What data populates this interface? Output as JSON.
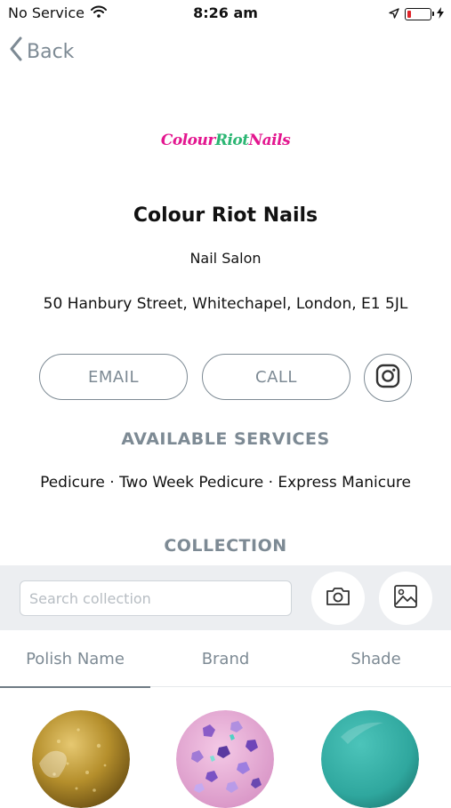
{
  "status_bar": {
    "carrier": "No Service",
    "time": "8:26 am",
    "battery_color": "#e0242a"
  },
  "nav": {
    "back_label": "Back",
    "back_icon": "chevron-left-icon"
  },
  "logo": {
    "part1": "Colour",
    "part2": "Riot",
    "part3": "Nails",
    "colors": {
      "primary": "#e3168f",
      "secondary": "#2bb673"
    }
  },
  "salon": {
    "name": "Colour Riot Nails",
    "type": "Nail Salon",
    "address": "50 Hanbury Street, Whitechapel, London, E1 5JL"
  },
  "actions": {
    "email_label": "EMAIL",
    "call_label": "CALL",
    "instagram_icon": "instagram-icon"
  },
  "services": {
    "title": "AVAILABLE SERVICES",
    "list": "Pedicure · Two Week Pedicure · Express Manicure"
  },
  "collection": {
    "title": "COLLECTION",
    "search_placeholder": "Search collection",
    "search_value": "",
    "camera_icon": "camera-icon",
    "gallery_icon": "image-gallery-icon",
    "tabs": [
      {
        "label": "Polish Name",
        "active": true
      },
      {
        "label": "Brand",
        "active": false
      },
      {
        "label": "Shade",
        "active": false
      }
    ],
    "swatches": [
      {
        "name": "gold-glitter",
        "color": "#b58f2c"
      },
      {
        "name": "pink-holo-glitter",
        "color": "#e3a6cf"
      },
      {
        "name": "teal",
        "color": "#2fa79e"
      }
    ]
  },
  "theme": {
    "muted_accent": "#7d8a94",
    "band_background": "#eceef1"
  }
}
